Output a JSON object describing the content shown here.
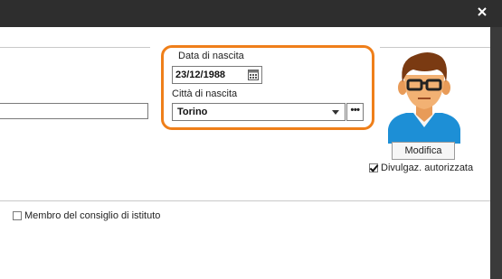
{
  "window": {
    "close_symbol": "✕"
  },
  "birth": {
    "date_label": "Data di nascita",
    "date_value": "23/12/1988",
    "city_label": "Città di nascita",
    "city_value": "Torino",
    "more_label": "•••"
  },
  "photo": {
    "edit_label": "Modifica",
    "disclosure_label": "Divulgaz. autorizzata",
    "disclosure_checked": true
  },
  "flags": {
    "council_member_label": "Membro del consiglio di istituto",
    "council_member_checked": false
  },
  "colors": {
    "highlight": "#ef7f1a",
    "titlebar": "#2e2e2e",
    "panel": "#ffffff"
  },
  "icons": {
    "close": "close-icon",
    "calendar": "calendar-icon",
    "dropdown": "chevron-down-icon",
    "avatar": "person-avatar-icon"
  }
}
